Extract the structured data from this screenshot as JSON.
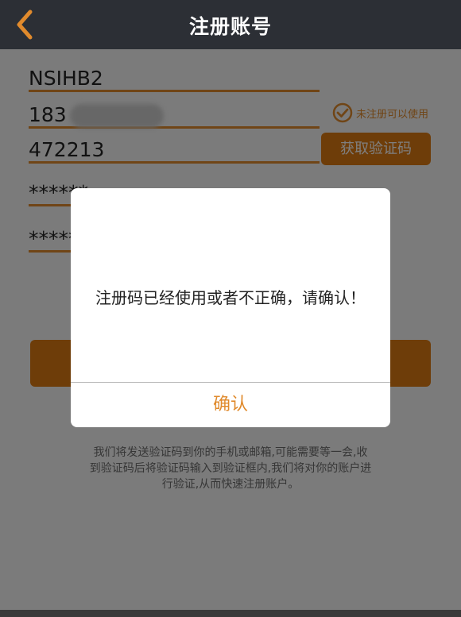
{
  "header": {
    "title": "注册账号"
  },
  "form": {
    "username": "NSIHB2",
    "phone_prefix": "183",
    "phone_status": "未注册可以使用",
    "verification_code": "472213",
    "get_code_button": "获取验证码",
    "password": "******",
    "password_confirm": "******"
  },
  "note": "我们将发送验证码到你的手机或邮箱,可能需要等一会,收到验证码后将验证码输入到验证框内,我们将对你的账户进行验证,从而快速注册账户。",
  "dialog": {
    "message": "注册码已经使用或者不正确，请确认！",
    "confirm_button": "确认"
  },
  "colors": {
    "accent": "#e08a2c",
    "button": "#dd7a12",
    "header_bg": "#2c2f35"
  },
  "icons": {
    "back": "chevron-left-icon",
    "check": "check-circle-icon"
  }
}
